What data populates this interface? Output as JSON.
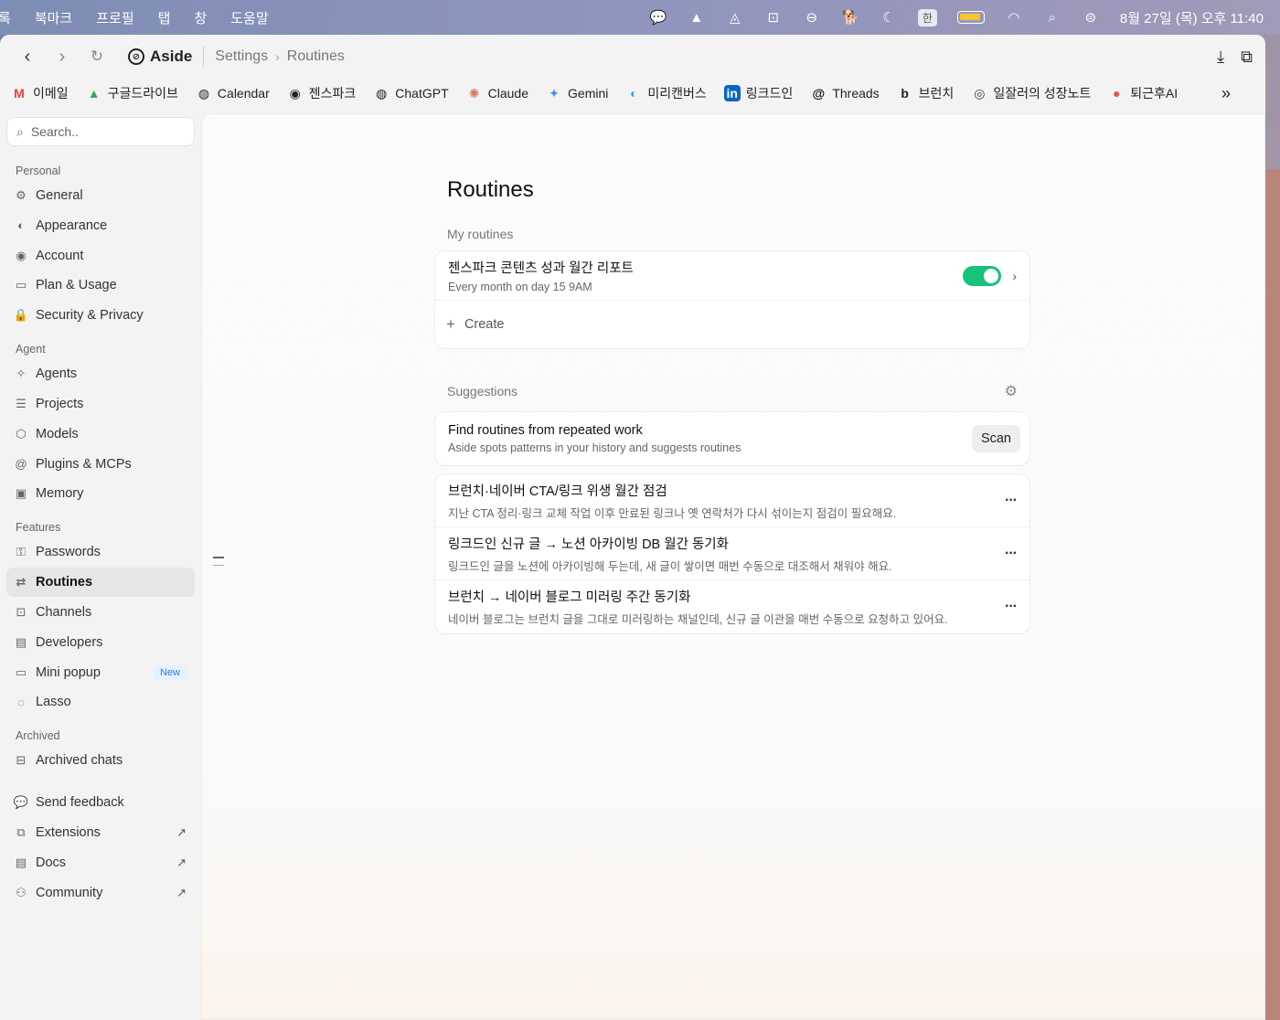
{
  "menubar": {
    "items": [
      "록",
      "북마크",
      "프로필",
      "탭",
      "창",
      "도움말"
    ],
    "ime": "한",
    "datetime": "8월 27일 (목) 오후 11:40"
  },
  "toolbar": {
    "brand": "Aside",
    "breadcrumb": [
      "Settings",
      "Routines"
    ]
  },
  "bookmarks": [
    {
      "label": "이메일",
      "icon": "gmail-icon",
      "color": "#ea4335",
      "glyph": "M"
    },
    {
      "label": "구글드라이브",
      "icon": "drive-icon",
      "color": "#34a853",
      "glyph": "▲"
    },
    {
      "label": "Calendar",
      "icon": "globe-icon",
      "color": "#222",
      "glyph": "◍"
    },
    {
      "label": "젠스파크",
      "icon": "genspark-icon",
      "color": "#222",
      "glyph": "◉"
    },
    {
      "label": "ChatGPT",
      "icon": "globe-icon",
      "color": "#222",
      "glyph": "◍"
    },
    {
      "label": "Claude",
      "icon": "claude-icon",
      "color": "#d97757",
      "glyph": "✺"
    },
    {
      "label": "Gemini",
      "icon": "gemini-icon",
      "color": "#4b8bf5",
      "glyph": "✦"
    },
    {
      "label": "미리캔버스",
      "icon": "miricanvas-icon",
      "color": "#19b5c4",
      "glyph": "◐"
    },
    {
      "label": "링크드인",
      "icon": "linkedin-icon",
      "color": "#0a66c2",
      "glyph": "in"
    },
    {
      "label": "Threads",
      "icon": "threads-icon",
      "color": "#111",
      "glyph": "@"
    },
    {
      "label": "브런치",
      "icon": "brunch-icon",
      "color": "#222",
      "glyph": "b"
    },
    {
      "label": "일잘러의 성장노트",
      "icon": "note-icon",
      "color": "#444",
      "glyph": "◎"
    },
    {
      "label": "퇴근후AI",
      "icon": "apple-icon",
      "color": "#e2554f",
      "glyph": "●"
    }
  ],
  "sidebar": {
    "search_placeholder": "Search..",
    "sections": [
      {
        "title": "Personal",
        "items": [
          {
            "label": "General",
            "icon": "gear-icon",
            "glyph": "⚙"
          },
          {
            "label": "Appearance",
            "icon": "appearance-icon",
            "glyph": "◐"
          },
          {
            "label": "Account",
            "icon": "account-icon",
            "glyph": "◉"
          },
          {
            "label": "Plan & Usage",
            "icon": "card-icon",
            "glyph": "▭"
          },
          {
            "label": "Security & Privacy",
            "icon": "lock-icon",
            "glyph": "🔒"
          }
        ]
      },
      {
        "title": "Agent",
        "items": [
          {
            "label": "Agents",
            "icon": "sparkle-icon",
            "glyph": "✧"
          },
          {
            "label": "Projects",
            "icon": "stack-icon",
            "glyph": "☰"
          },
          {
            "label": "Models",
            "icon": "cube-icon",
            "glyph": "⬡"
          },
          {
            "label": "Plugins & MCPs",
            "icon": "at-icon",
            "glyph": "@"
          },
          {
            "label": "Memory",
            "icon": "chip-icon",
            "glyph": "▣"
          }
        ]
      },
      {
        "title": "Features",
        "items": [
          {
            "label": "Passwords",
            "icon": "key-icon",
            "glyph": "⚿"
          },
          {
            "label": "Routines",
            "icon": "repeat-icon",
            "glyph": "⇄",
            "active": true
          },
          {
            "label": "Channels",
            "icon": "channels-icon",
            "glyph": "⊡"
          },
          {
            "label": "Developers",
            "icon": "code-icon",
            "glyph": "▤"
          },
          {
            "label": "Mini popup",
            "icon": "popup-icon",
            "glyph": "▭",
            "badge": "New"
          },
          {
            "label": "Lasso",
            "icon": "lasso-icon",
            "glyph": "◌"
          }
        ]
      },
      {
        "title": "Archived",
        "items": [
          {
            "label": "Archived chats",
            "icon": "archive-icon",
            "glyph": "⊟"
          }
        ]
      }
    ],
    "footer": [
      {
        "label": "Send feedback",
        "icon": "feedback-icon",
        "glyph": "💬"
      },
      {
        "label": "Extensions",
        "icon": "puzzle-icon",
        "glyph": "⧉",
        "external": "↗"
      },
      {
        "label": "Docs",
        "icon": "docs-icon",
        "glyph": "▤",
        "external": "↗"
      },
      {
        "label": "Community",
        "icon": "people-icon",
        "glyph": "⚇",
        "external": "↗"
      }
    ]
  },
  "main": {
    "title": "Routines",
    "my_routines_label": "My routines",
    "routines": [
      {
        "title": "젠스파크 콘텐츠 성과 월간 리포트",
        "schedule": "Every month on day 15 9AM",
        "enabled": true
      }
    ],
    "create_label": "Create",
    "suggestions_label": "Suggestions",
    "find": {
      "title": "Find routines from repeated work",
      "subtitle": "Aside spots patterns in your history and suggests routines",
      "button": "Scan"
    },
    "suggestions": [
      {
        "title": "브런치·네이버 CTA/링크 위생 월간 점검",
        "desc": "지난 CTA 정리·링크 교체 작업 이후 만료된 링크나 옛 연락처가 다시 섞이는지 점검이 필요해요."
      },
      {
        "title": "링크드인 신규 글 → 노션 아카이빙 DB 월간 동기화",
        "desc": "링크드인 글을 노션에 아카이빙해 두는데, 새 글이 쌓이면 매번 수동으로 대조해서 채워야 해요."
      },
      {
        "title": "브런치 → 네이버 블로그 미러링 주간 동기화",
        "desc": "네이버 블로그는 브런치 글을 그대로 미러링하는 채널인데, 신규 글 이관을 매번 수동으로 요청하고 있어요."
      }
    ]
  }
}
